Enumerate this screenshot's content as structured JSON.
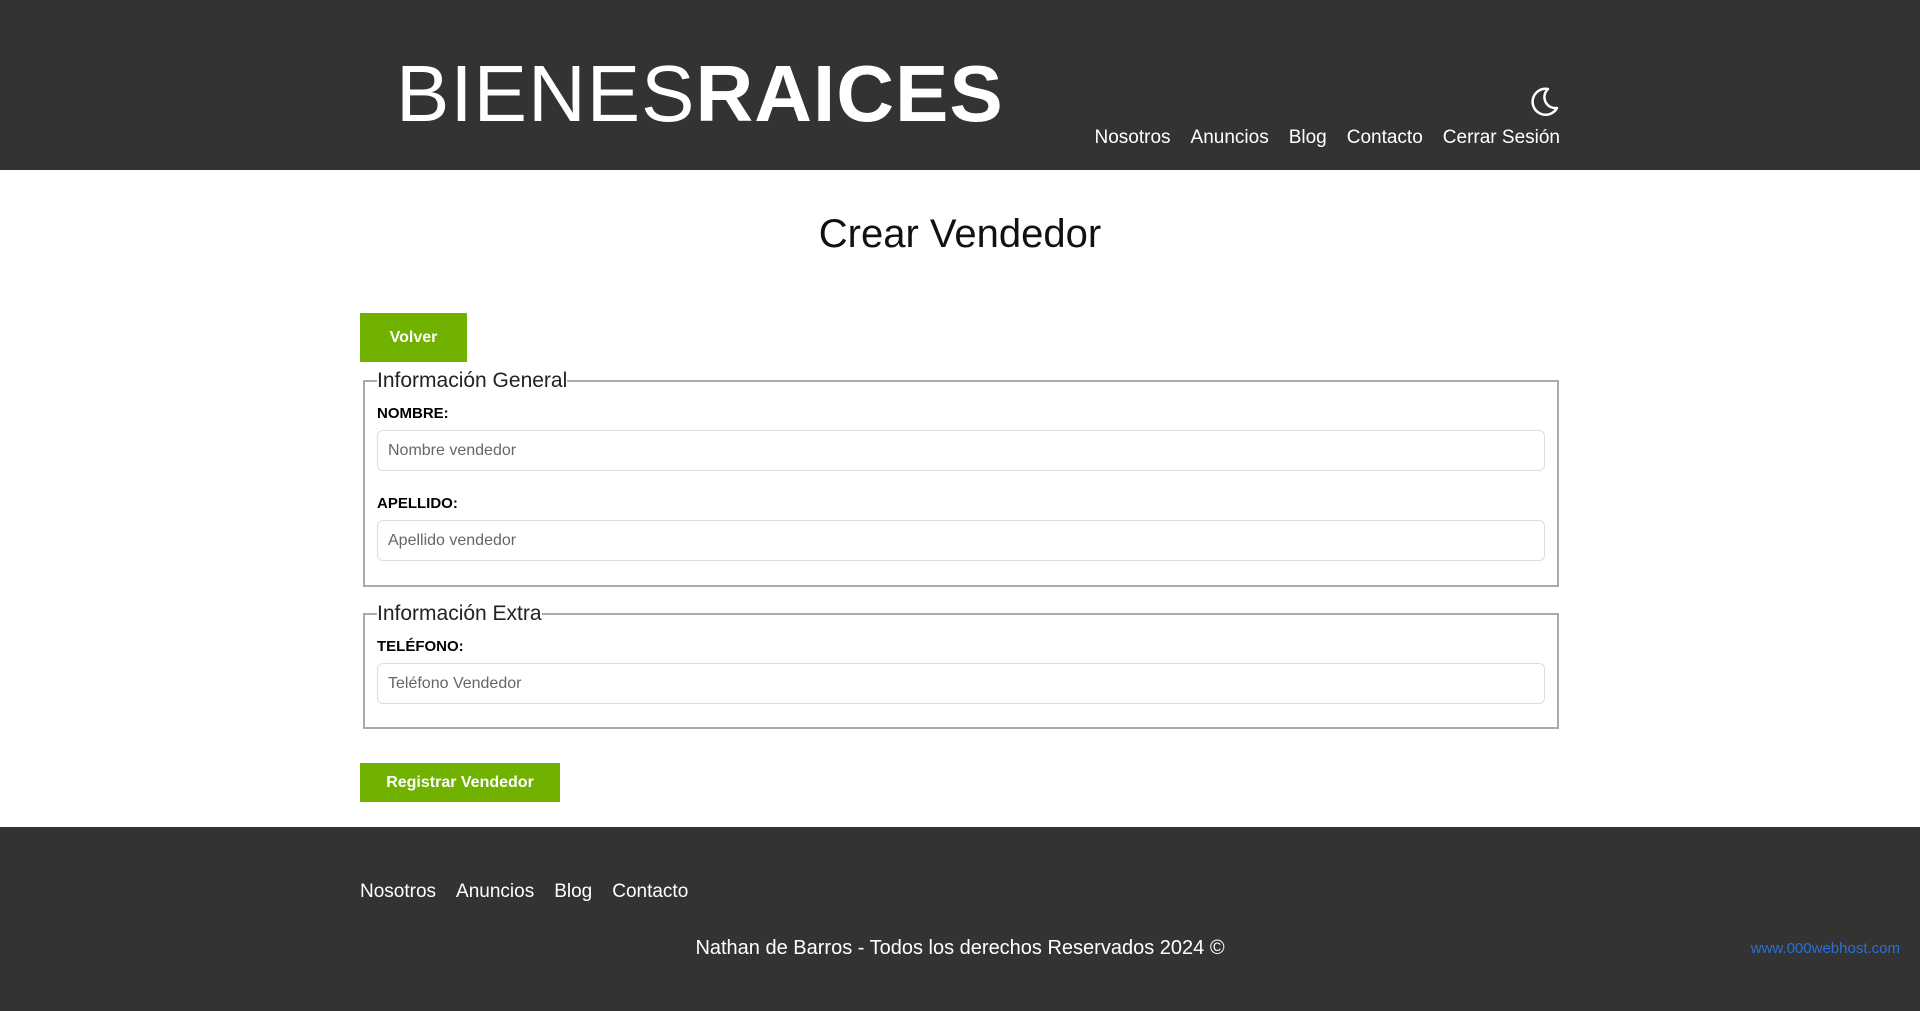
{
  "header": {
    "logo_thin": "BIENES",
    "logo_bold": "RAICES",
    "theme_toggle_icon": "moon-icon",
    "nav": [
      {
        "label": "Nosotros"
      },
      {
        "label": "Anuncios"
      },
      {
        "label": "Blog"
      },
      {
        "label": "Contacto"
      },
      {
        "label": "Cerrar Sesión"
      }
    ]
  },
  "main": {
    "title": "Crear Vendedor",
    "back_button": "Volver",
    "general": {
      "legend": "Información General",
      "nombre_label": "NOMBRE:",
      "nombre_placeholder": "Nombre vendedor",
      "apellido_label": "APELLIDO:",
      "apellido_placeholder": "Apellido vendedor"
    },
    "extra": {
      "legend": "Información Extra",
      "telefono_label": "TELÉFONO:",
      "telefono_placeholder": "Teléfono Vendedor"
    },
    "submit_button": "Registrar Vendedor"
  },
  "footer": {
    "nav": [
      {
        "label": "Nosotros"
      },
      {
        "label": "Anuncios"
      },
      {
        "label": "Blog"
      },
      {
        "label": "Contacto"
      }
    ],
    "copyright": "Nathan de Barros - Todos los derechos Reservados 2024 ©",
    "host_link": "www.000webhost.com"
  },
  "colors": {
    "dark_bg": "#333333",
    "accent_green": "#71b100",
    "link_blue": "#2a6fd6"
  }
}
